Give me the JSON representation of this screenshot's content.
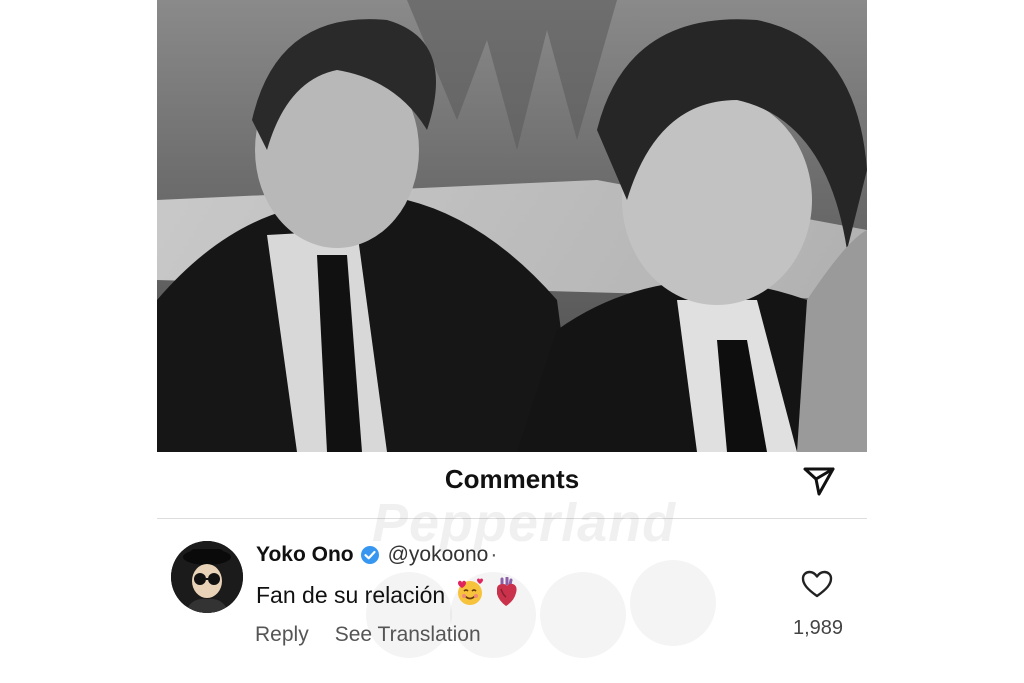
{
  "photo": {
    "description_icon": "photo-image"
  },
  "comments_header": {
    "title": "Comments",
    "share_icon": "send-icon"
  },
  "watermark": {
    "text": "Pepperland"
  },
  "comment": {
    "avatar_icon": "avatar-icon",
    "username": "Yoko Ono",
    "verified_icon": "verified-badge-icon",
    "handle": "@yokoono",
    "separator": "·",
    "text": "Fan de su relación",
    "emoji_face": "🥰",
    "emoji_heart": "anatomical-heart",
    "reply_label": "Reply",
    "translate_label": "See Translation",
    "like_count": "1,989",
    "like_icon": "heart-icon"
  },
  "colors": {
    "verified": "#3797f0",
    "text_primary": "#111111",
    "text_secondary": "#555555"
  }
}
